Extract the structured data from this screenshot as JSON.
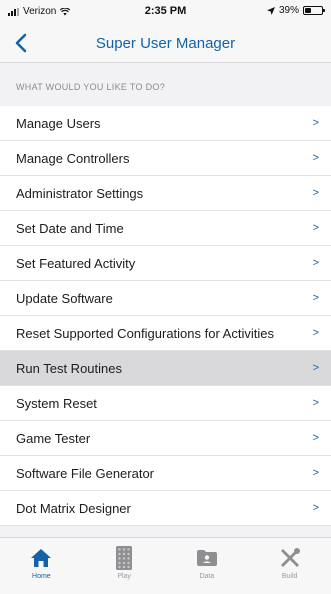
{
  "status_bar": {
    "carrier": "Verizon",
    "time": "2:35 PM",
    "battery": "39%",
    "battery_level": 0.39
  },
  "nav": {
    "title": "Super User Manager",
    "back_icon": "chevron-left-icon"
  },
  "section": {
    "header": "WHAT WOULD YOU LIKE TO DO?"
  },
  "menu": {
    "chevron": ">",
    "items": [
      {
        "label": "Manage Users"
      },
      {
        "label": "Manage Controllers"
      },
      {
        "label": "Administrator Settings"
      },
      {
        "label": "Set Date and Time"
      },
      {
        "label": "Set Featured Activity"
      },
      {
        "label": "Update Software"
      },
      {
        "label": "Reset Supported Configurations for Activities"
      },
      {
        "label": "Run Test Routines",
        "highlighted": true
      },
      {
        "label": "System Reset"
      },
      {
        "label": "Game Tester"
      },
      {
        "label": "Software File Generator"
      },
      {
        "label": "Dot Matrix Designer"
      }
    ]
  },
  "tabs": [
    {
      "label": "Home",
      "icon": "home-icon",
      "active": true
    },
    {
      "label": "Play",
      "icon": "dot-matrix-icon",
      "active": false
    },
    {
      "label": "Data",
      "icon": "folder-icon",
      "active": false
    },
    {
      "label": "Build",
      "icon": "tools-icon",
      "active": false
    }
  ],
  "colors": {
    "accent": "#1462a8",
    "inactive": "#9a9a9e",
    "highlight_row": "#d9d9dc"
  }
}
